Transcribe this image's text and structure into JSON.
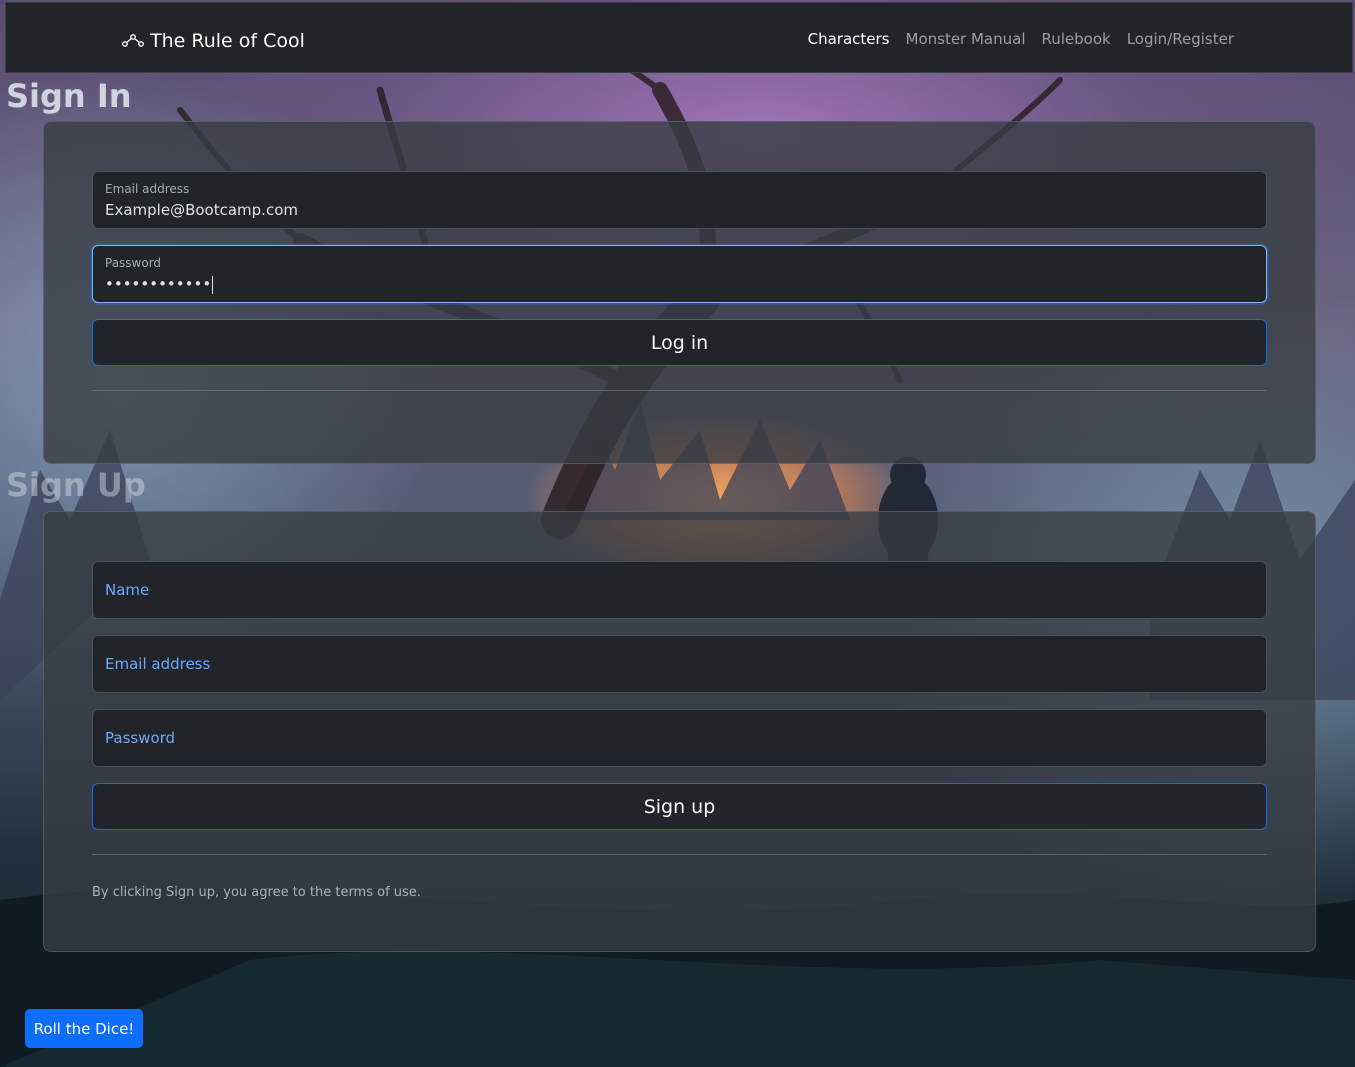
{
  "navbar": {
    "brand_icon": "dice-network-icon",
    "brand": "The Rule of Cool",
    "links": [
      {
        "label": "Characters",
        "active": true
      },
      {
        "label": "Monster Manual",
        "active": false
      },
      {
        "label": "Rulebook",
        "active": false
      },
      {
        "label": "Login/Register",
        "active": false
      }
    ]
  },
  "signin": {
    "title": "Sign In",
    "email_label": "Email address",
    "email_value": "Example@Bootcamp.com",
    "password_label": "Password",
    "password_value": "••••••••••••",
    "submit_label": "Log in"
  },
  "signup": {
    "title": "Sign Up",
    "name_placeholder": "Name",
    "email_placeholder": "Email address",
    "password_placeholder": "Password",
    "submit_label": "Sign up",
    "terms": "By clicking Sign up, you agree to the terms of use."
  },
  "roll_button": "Roll the Dice!",
  "colors": {
    "navbar_bg": "#212529",
    "accent": "#0d6efd",
    "placeholder": "#6ea8fe"
  }
}
